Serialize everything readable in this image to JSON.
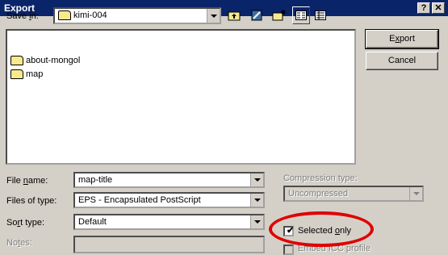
{
  "window": {
    "title": "Export",
    "help_label": "?",
    "close_label": "✕"
  },
  "save_in": {
    "label_pre": "Save ",
    "label_underline": "i",
    "label_post": "n:",
    "value": "kimi-004",
    "icons": [
      "up-folder-icon",
      "desktop-icon",
      "new-folder-icon",
      "list-view-icon",
      "details-view-icon"
    ]
  },
  "file_list": {
    "items": [
      {
        "name": "about-mongol",
        "icon": "folder-icon"
      },
      {
        "name": "map",
        "icon": "folder-icon"
      }
    ]
  },
  "buttons": {
    "export_pre": "E",
    "export_underline": "x",
    "export_post": "port",
    "cancel": "Cancel"
  },
  "file_name": {
    "label_pre": "File ",
    "label_underline": "n",
    "label_post": "ame:",
    "value": "map-title"
  },
  "file_type": {
    "label": "Files of type:",
    "value": "EPS - Encapsulated PostScript"
  },
  "sort_type": {
    "label_pre": "So",
    "label_underline": "r",
    "label_post": "t type:",
    "value": "Default"
  },
  "notes": {
    "label_pre": "No",
    "label_underline": "t",
    "label_post": "es:"
  },
  "compression": {
    "label": "Compression type:",
    "value": "Uncompressed"
  },
  "selected_only": {
    "label_pre": "Selected ",
    "label_underline": "o",
    "label_post": "nly",
    "checked": true
  },
  "icc_profile": {
    "label": "Embed ICC profile"
  },
  "colors": {
    "titlebar": "#0a246a",
    "highlight": "#e00000"
  }
}
